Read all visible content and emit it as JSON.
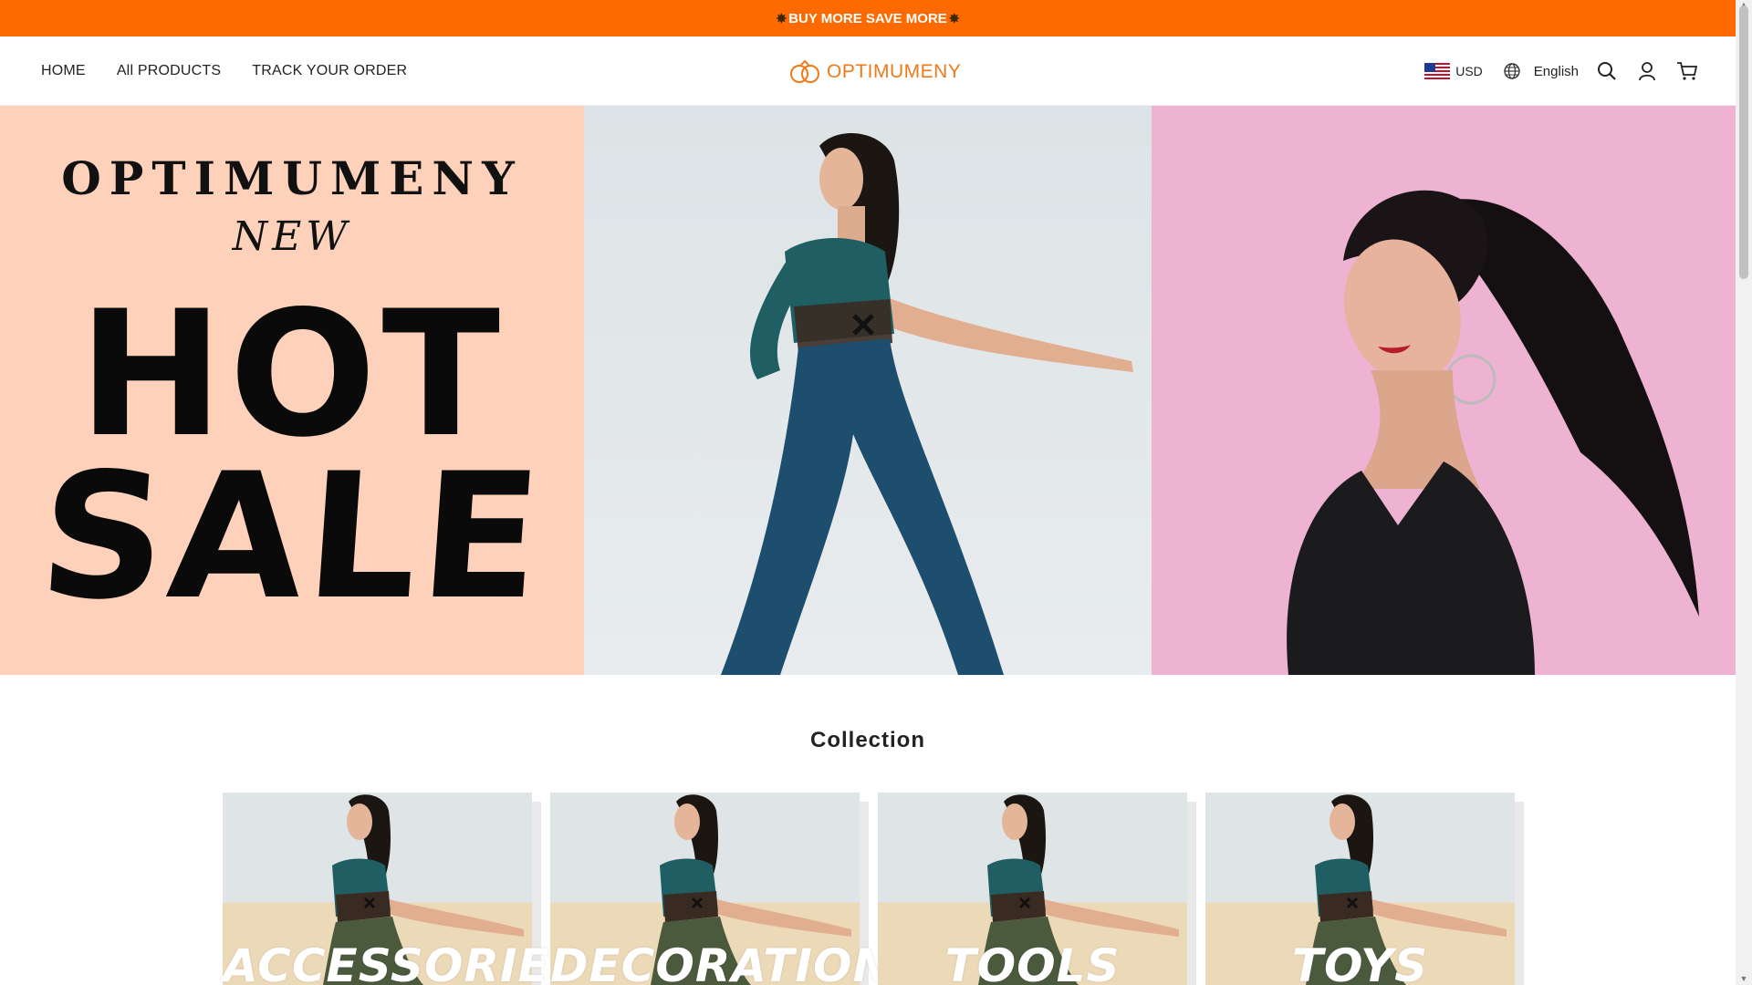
{
  "announcement": {
    "text": "BUY MORE SAVE MORE"
  },
  "nav": {
    "home": "HOME",
    "all_products": "All PRODUCTS",
    "track_order": "TRACK YOUR ORDER"
  },
  "logo": {
    "text": "OPTIMUMENY"
  },
  "header_actions": {
    "currency": "USD",
    "language": "English"
  },
  "hero": {
    "brand": "OPTIMUMENY",
    "subtitle": "NEW",
    "headline_1": "HOT",
    "headline_2": "SALE"
  },
  "collection": {
    "title": "Collection",
    "items": [
      {
        "label": "ACCESSORIES"
      },
      {
        "label": "DECORATIONS"
      },
      {
        "label": "TOOLS"
      },
      {
        "label": "TOYS"
      }
    ]
  },
  "colors": {
    "accent": "#ff6a00",
    "logo": "#f07a1a",
    "hero_left_bg": "#fdd1ba",
    "hero_right_bg": "#eeb2d3"
  }
}
